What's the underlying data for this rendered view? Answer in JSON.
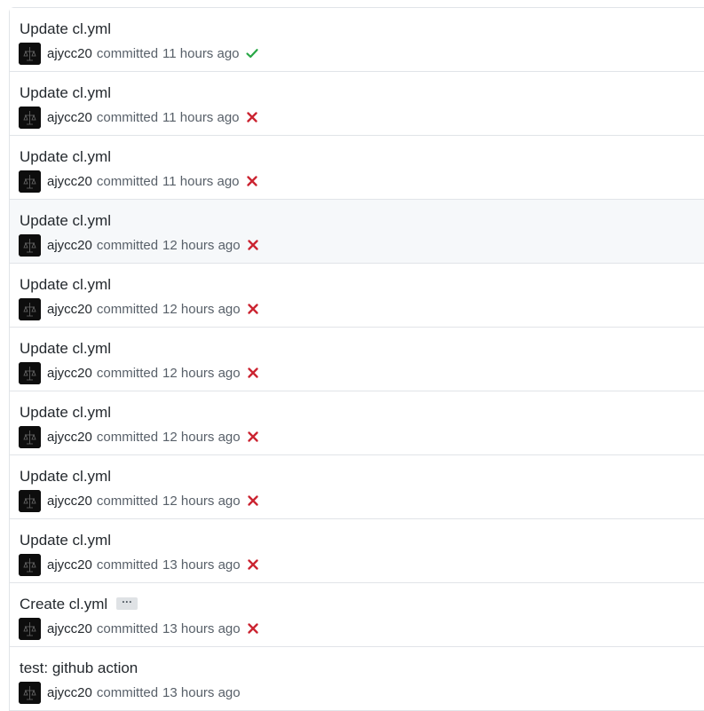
{
  "commits": [
    {
      "title": "Update cl.yml",
      "author": "ajycc20",
      "verb": "committed",
      "time": "11 hours ago",
      "status": "success"
    },
    {
      "title": "Update cl.yml",
      "author": "ajycc20",
      "verb": "committed",
      "time": "11 hours ago",
      "status": "failure"
    },
    {
      "title": "Update cl.yml",
      "author": "ajycc20",
      "verb": "committed",
      "time": "11 hours ago",
      "status": "failure"
    },
    {
      "title": "Update cl.yml",
      "author": "ajycc20",
      "verb": "committed",
      "time": "12 hours ago",
      "status": "failure"
    },
    {
      "title": "Update cl.yml",
      "author": "ajycc20",
      "verb": "committed",
      "time": "12 hours ago",
      "status": "failure"
    },
    {
      "title": "Update cl.yml",
      "author": "ajycc20",
      "verb": "committed",
      "time": "12 hours ago",
      "status": "failure"
    },
    {
      "title": "Update cl.yml",
      "author": "ajycc20",
      "verb": "committed",
      "time": "12 hours ago",
      "status": "failure"
    },
    {
      "title": "Update cl.yml",
      "author": "ajycc20",
      "verb": "committed",
      "time": "12 hours ago",
      "status": "failure"
    },
    {
      "title": "Update cl.yml",
      "author": "ajycc20",
      "verb": "committed",
      "time": "13 hours ago",
      "status": "failure"
    },
    {
      "title": "Create cl.yml",
      "author": "ajycc20",
      "verb": "committed",
      "time": "13 hours ago",
      "status": "failure",
      "ellipsis": "···"
    },
    {
      "title": "test: github action",
      "author": "ajycc20",
      "verb": "committed",
      "time": "13 hours ago",
      "status": "none"
    }
  ],
  "colors": {
    "success": "#28a745",
    "failure": "#cb2431",
    "row_hover": "#f6f8fa",
    "border": "#e1e4e8"
  },
  "icons": {
    "success": "check-icon",
    "failure": "x-icon"
  }
}
